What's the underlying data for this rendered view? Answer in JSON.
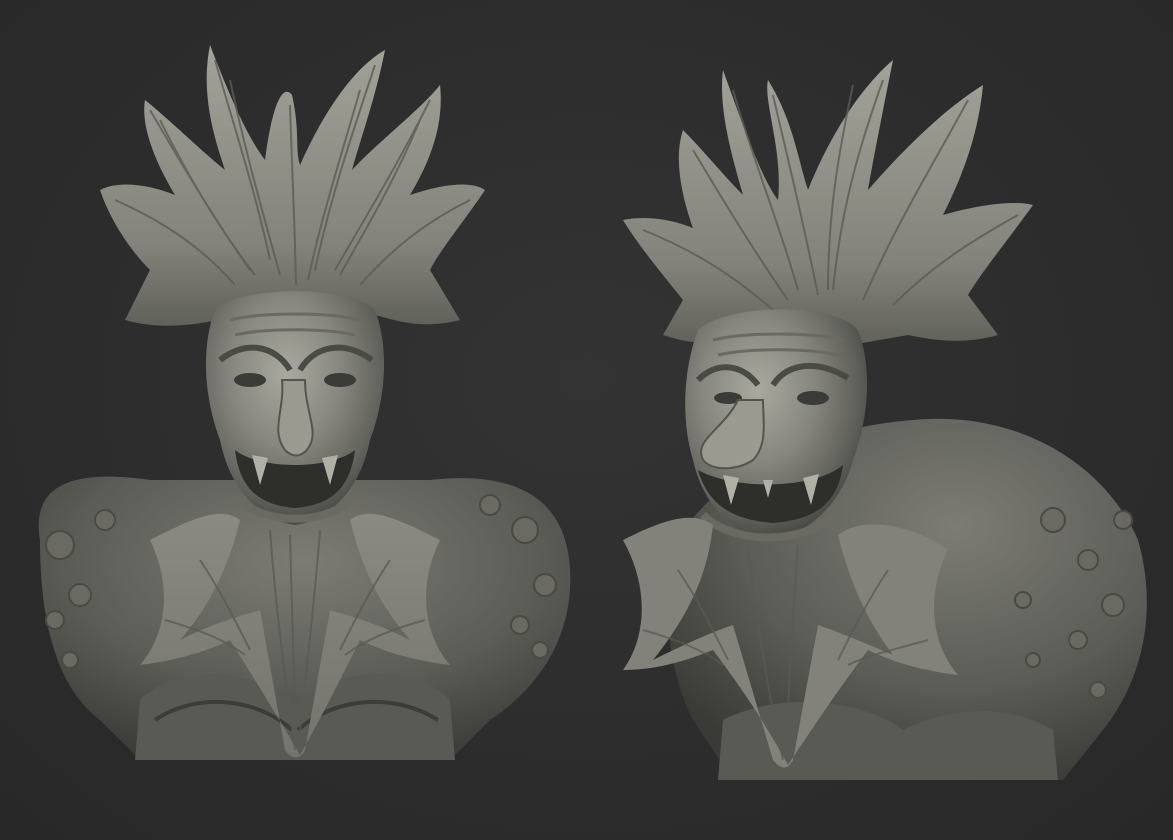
{
  "scene": {
    "background": "#2b2b2b",
    "material": {
      "base": "#8a8a82",
      "highlight": "#b3b3aa",
      "mid": "#6f6f68",
      "shadow": "#3f3f3b",
      "deep": "#2c2c29"
    },
    "views": [
      {
        "id": "front",
        "subject": "sculpted-demon-bust",
        "angle": "front"
      },
      {
        "id": "three-quarter",
        "subject": "sculpted-demon-bust",
        "angle": "three-quarter-left"
      }
    ]
  }
}
